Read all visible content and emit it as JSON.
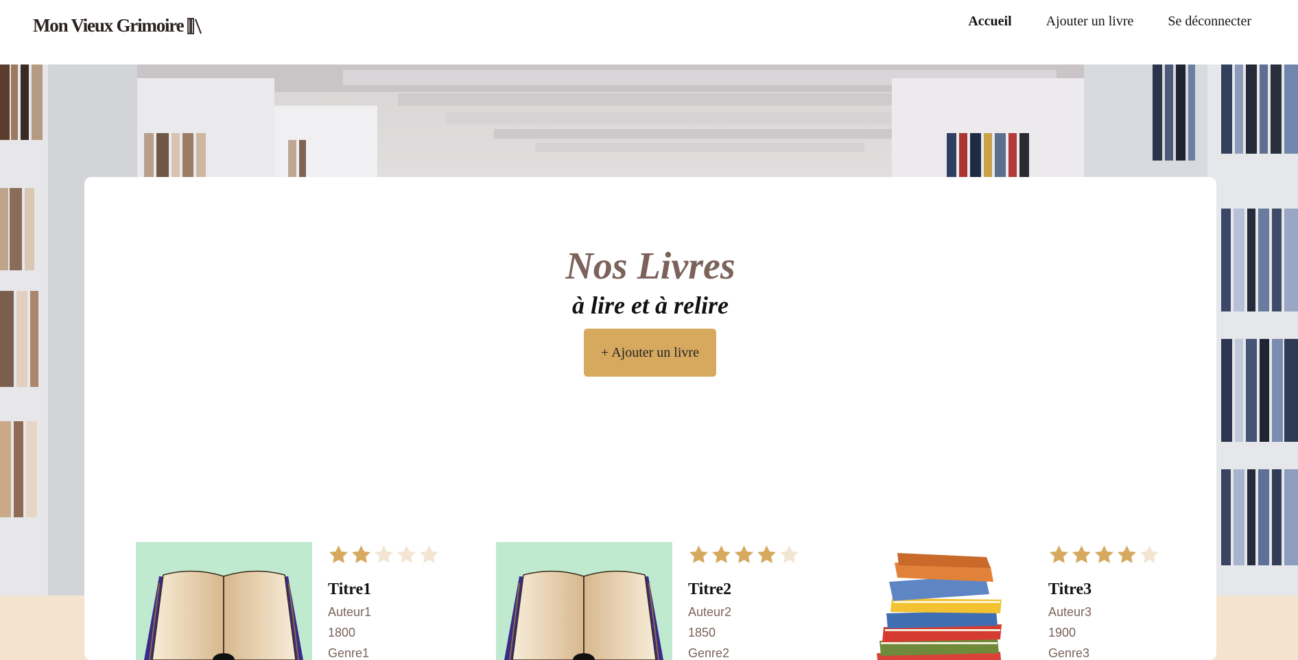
{
  "header": {
    "logo_text": "Mon Vieux Grimoire",
    "nav": {
      "home": "Accueil",
      "add_book": "Ajouter un livre",
      "logout": "Se déconnecter"
    }
  },
  "main": {
    "title": "Nos Livres",
    "subtitle": "à lire et à relire",
    "add_button": "+ Ajouter un livre"
  },
  "books": [
    {
      "title": "Titre1",
      "author": "Auteur1",
      "year": "1800",
      "genre": "Genre1",
      "rating": 2,
      "max_rating": 5,
      "cover": "open-book"
    },
    {
      "title": "Titre2",
      "author": "Auteur2",
      "year": "1850",
      "genre": "Genre2",
      "rating": 4,
      "max_rating": 5,
      "cover": "open-book"
    },
    {
      "title": "Titre3",
      "author": "Auteur3",
      "year": "1900",
      "genre": "Genre3",
      "rating": 4,
      "max_rating": 5,
      "cover": "book-stack"
    }
  ],
  "colors": {
    "accent": "#d6a95f",
    "title_brown": "#7b625a",
    "star_filled": "#d6a95f",
    "star_empty": "#f2e6d3",
    "cover_green": "#bfead0",
    "footer_beige": "#f3e3cf"
  },
  "icons": {
    "logo": "books-on-shelf-icon",
    "star": "star-icon"
  }
}
